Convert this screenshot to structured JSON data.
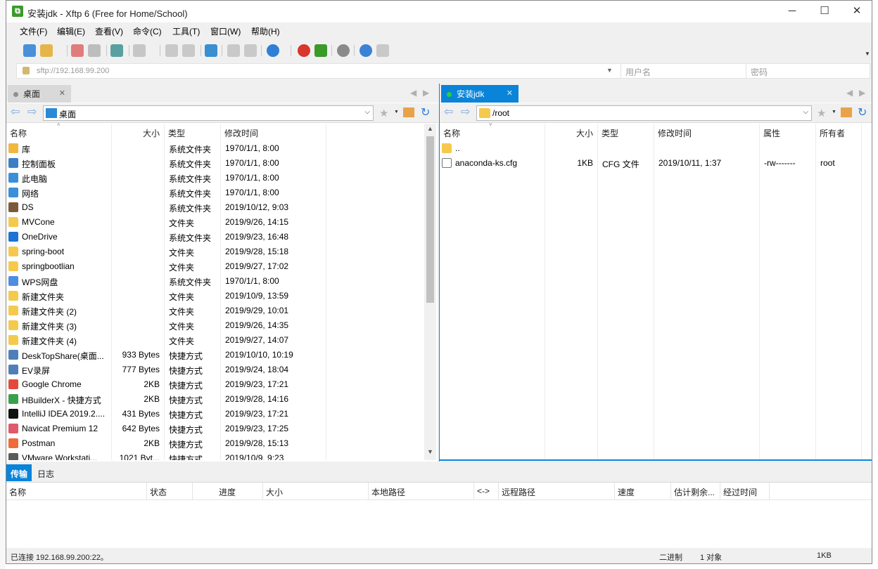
{
  "window": {
    "title": "安装jdk - Xftp 6 (Free for Home/School)",
    "icon_name": "xftp-app-icon"
  },
  "menu": [
    "文件(F)",
    "编辑(E)",
    "查看(V)",
    "命令(C)",
    "工具(T)",
    "窗口(W)",
    "帮助(H)"
  ],
  "toolbar": {
    "icons": [
      "new-session-icon",
      "open-folder-icon",
      "disconnect-icon",
      "reconnect-icon",
      "sync-icon",
      "play-icon",
      "copy-icon",
      "paste-icon",
      "transfer-icon",
      "local-copy-icon",
      "remote-copy-icon",
      "globe-icon",
      "xshell-icon",
      "xftp-icon",
      "settings-icon",
      "help-icon",
      "chat-icon"
    ]
  },
  "address": {
    "url": "sftp://192.168.99.200",
    "user_placeholder": "用户名",
    "pass_placeholder": "密码"
  },
  "left": {
    "tab": "桌面",
    "path": "桌面",
    "columns": [
      "名称",
      "大小",
      "类型",
      "修改时间"
    ],
    "rows": [
      {
        "name": "库",
        "size": "",
        "type": "系统文件夹",
        "date": "1970/1/1, 8:00",
        "icon": "library-icon"
      },
      {
        "name": "控制面板",
        "size": "",
        "type": "系统文件夹",
        "date": "1970/1/1, 8:00",
        "icon": "control-panel-icon"
      },
      {
        "name": "此电脑",
        "size": "",
        "type": "系统文件夹",
        "date": "1970/1/1, 8:00",
        "icon": "computer-icon"
      },
      {
        "name": "网络",
        "size": "",
        "type": "系统文件夹",
        "date": "1970/1/1, 8:00",
        "icon": "network-icon"
      },
      {
        "name": "DS",
        "size": "",
        "type": "系统文件夹",
        "date": "2019/10/12, 9:03",
        "icon": "user-icon"
      },
      {
        "name": "MVCone",
        "size": "",
        "type": "文件夹",
        "date": "2019/9/26, 14:15",
        "icon": "folder-icon"
      },
      {
        "name": "OneDrive",
        "size": "",
        "type": "系统文件夹",
        "date": "2019/9/23, 16:48",
        "icon": "cloud-icon"
      },
      {
        "name": "spring-boot",
        "size": "",
        "type": "文件夹",
        "date": "2019/9/28, 15:18",
        "icon": "folder-icon"
      },
      {
        "name": "springbootlian",
        "size": "",
        "type": "文件夹",
        "date": "2019/9/27, 17:02",
        "icon": "folder-icon"
      },
      {
        "name": "WPS网盘",
        "size": "",
        "type": "系统文件夹",
        "date": "1970/1/1, 8:00",
        "icon": "cloud-outline-icon"
      },
      {
        "name": "新建文件夹",
        "size": "",
        "type": "文件夹",
        "date": "2019/10/9, 13:59",
        "icon": "folder-icon"
      },
      {
        "name": "新建文件夹 (2)",
        "size": "",
        "type": "文件夹",
        "date": "2019/9/29, 10:01",
        "icon": "folder-icon"
      },
      {
        "name": "新建文件夹 (3)",
        "size": "",
        "type": "文件夹",
        "date": "2019/9/26, 14:35",
        "icon": "folder-icon"
      },
      {
        "name": "新建文件夹 (4)",
        "size": "",
        "type": "文件夹",
        "date": "2019/9/27, 14:07",
        "icon": "folder-icon"
      },
      {
        "name": "DeskTopShare(桌面...",
        "size": "933 Bytes",
        "type": "快捷方式",
        "date": "2019/10/10, 10:19",
        "icon": "shortcut-icon"
      },
      {
        "name": "EV录屏",
        "size": "777 Bytes",
        "type": "快捷方式",
        "date": "2019/9/24, 18:04",
        "icon": "shortcut-icon"
      },
      {
        "name": "Google Chrome",
        "size": "2KB",
        "type": "快捷方式",
        "date": "2019/9/23, 17:21",
        "icon": "chrome-icon"
      },
      {
        "name": "HBuilderX - 快捷方式",
        "size": "2KB",
        "type": "快捷方式",
        "date": "2019/9/28, 14:16",
        "icon": "hbuilder-icon"
      },
      {
        "name": "IntelliJ IDEA 2019.2....",
        "size": "431 Bytes",
        "type": "快捷方式",
        "date": "2019/9/23, 17:21",
        "icon": "intellij-icon"
      },
      {
        "name": "Navicat Premium 12",
        "size": "642 Bytes",
        "type": "快捷方式",
        "date": "2019/9/23, 17:25",
        "icon": "navicat-icon"
      },
      {
        "name": "Postman",
        "size": "2KB",
        "type": "快捷方式",
        "date": "2019/9/28, 15:13",
        "icon": "postman-icon"
      },
      {
        "name": "VMware Workstati...",
        "size": "1021 Byt...",
        "type": "快捷方式",
        "date": "2019/10/9, 9:23",
        "icon": "vmware-icon"
      }
    ]
  },
  "right": {
    "tab": "安装jdk",
    "path": "/root",
    "columns": [
      "名称",
      "大小",
      "类型",
      "修改时间",
      "属性",
      "所有者"
    ],
    "rows": [
      {
        "name": "..",
        "size": "",
        "type": "",
        "date": "",
        "attr": "",
        "owner": "",
        "icon": "folder-icon"
      },
      {
        "name": "anaconda-ks.cfg",
        "size": "1KB",
        "type": "CFG 文件",
        "date": "2019/10/11, 1:37",
        "attr": "-rw-------",
        "owner": "root",
        "icon": "file-icon"
      }
    ]
  },
  "bottom_tabs": [
    "传输",
    "日志"
  ],
  "transfer_columns": [
    "名称",
    "状态",
    "进度",
    "大小",
    "本地路径",
    "<->",
    "远程路径",
    "速度",
    "估计剩余...",
    "经过时间"
  ],
  "status": {
    "connection": "已连接 192.168.99.200:22。",
    "mode": "二进制",
    "objects": "1 对象",
    "size": "1KB"
  },
  "colors": {
    "accent": "#0a84d8",
    "folder": "#f5c94c"
  }
}
